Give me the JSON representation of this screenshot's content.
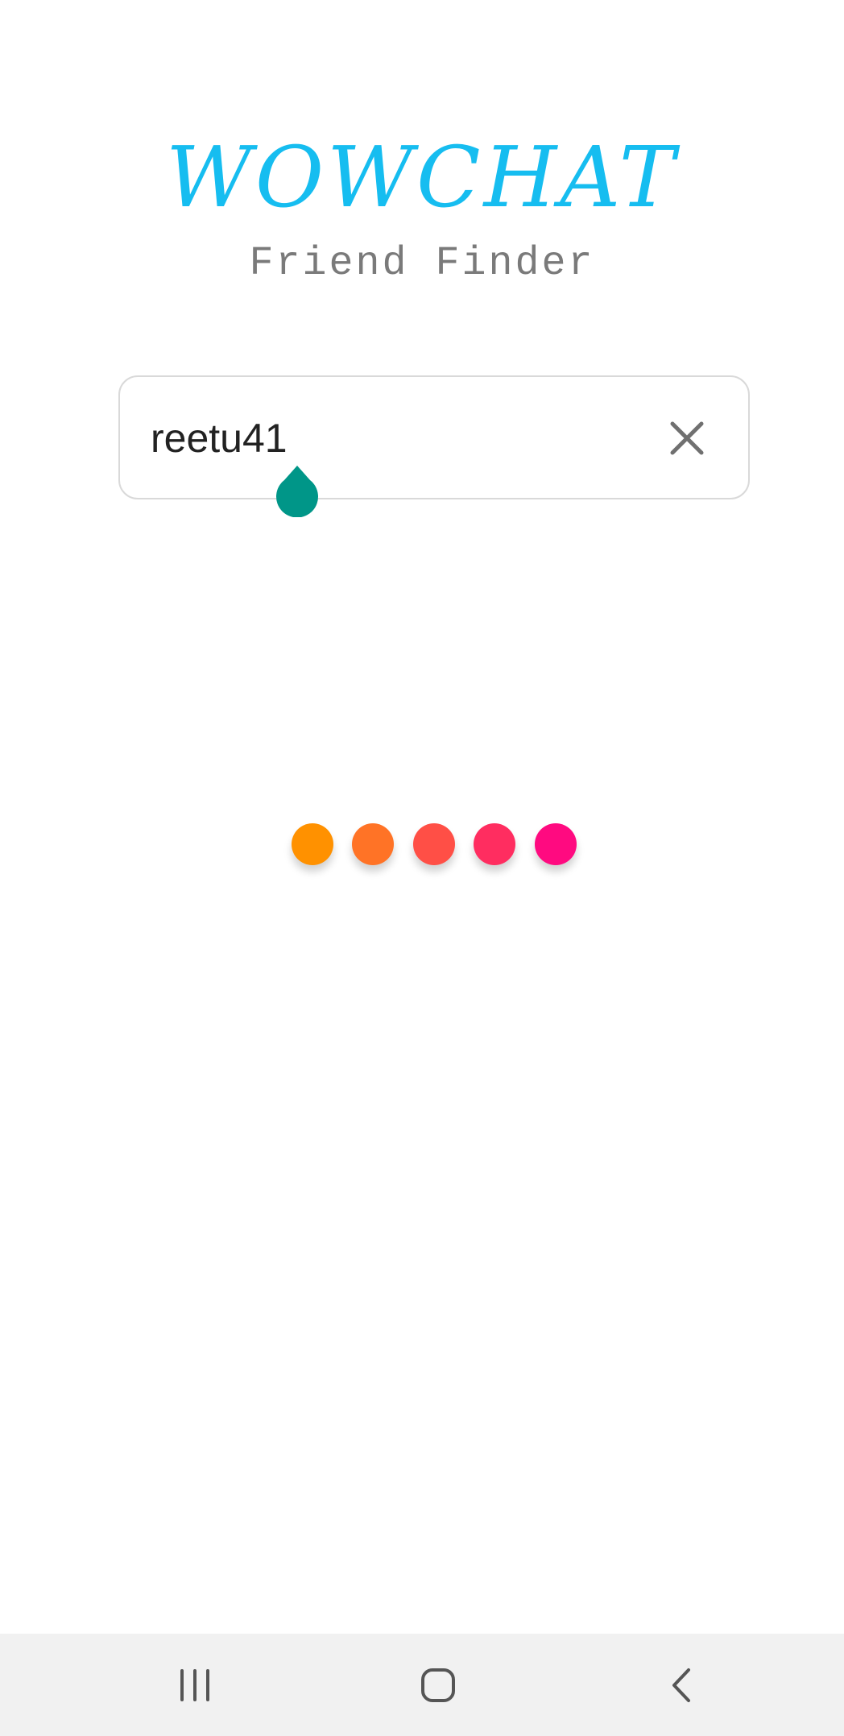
{
  "app": {
    "title": "WOWCHAT",
    "subtitle": "Friend Finder"
  },
  "search": {
    "value": "reetu41",
    "placeholder": ""
  },
  "icons": {
    "clear": "close-icon",
    "cursor_handle": "text-cursor-handle-icon",
    "nav_recents": "recent-apps-icon",
    "nav_home": "home-icon",
    "nav_back": "back-icon"
  },
  "colors": {
    "title": "#16bdf0",
    "subtitle": "#7a7a7a",
    "cursor_handle": "#009688",
    "icon": "#707070",
    "nav_icon": "#555555",
    "loading_dots": [
      "#ff9100",
      "#ff7326",
      "#ff4f46",
      "#ff2d60",
      "#ff0a80"
    ]
  }
}
